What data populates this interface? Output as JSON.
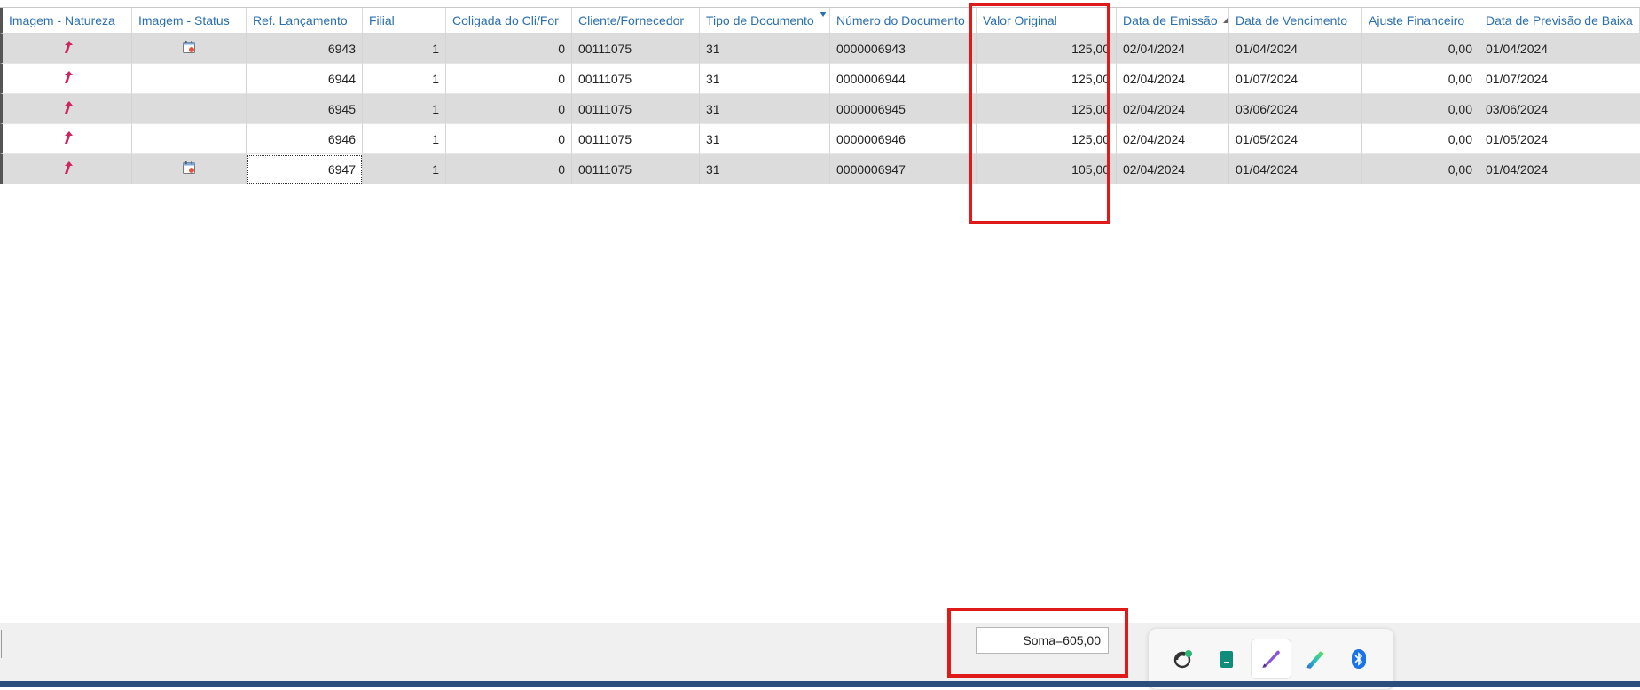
{
  "table": {
    "headers": [
      "Imagem - Natureza",
      "Imagem - Status",
      "Ref. Lançamento",
      "Filial",
      "Coligada do Cli/For",
      "Cliente/Fornecedor",
      "Tipo de Documento",
      "Número do Documento",
      "Valor Original",
      "Data de Emissão",
      "Data de Vencimento",
      "Ajuste Financeiro",
      "Data de Previsão de Baixa"
    ],
    "sorted_column": "Data de Emissão",
    "sort_direction": "ascending",
    "filtered_column": "Tipo de Documento",
    "rows": [
      {
        "natureza_icon": "up-arrow-icon",
        "status_icon": "calendar-icon",
        "ref": "6943",
        "filial": "1",
        "coligada": "0",
        "cliente": "00111075",
        "tipo": "31",
        "numero": "0000006943",
        "valor": "125,00",
        "emissao": "02/04/2024",
        "vencimento": "01/04/2024",
        "ajuste": "0,00",
        "previsao": "01/04/2024"
      },
      {
        "natureza_icon": "up-arrow-icon",
        "status_icon": "",
        "ref": "6944",
        "filial": "1",
        "coligada": "0",
        "cliente": "00111075",
        "tipo": "31",
        "numero": "0000006944",
        "valor": "125,00",
        "emissao": "02/04/2024",
        "vencimento": "01/07/2024",
        "ajuste": "0,00",
        "previsao": "01/07/2024"
      },
      {
        "natureza_icon": "up-arrow-icon",
        "status_icon": "",
        "ref": "6945",
        "filial": "1",
        "coligada": "0",
        "cliente": "00111075",
        "tipo": "31",
        "numero": "0000006945",
        "valor": "125,00",
        "emissao": "02/04/2024",
        "vencimento": "03/06/2024",
        "ajuste": "0,00",
        "previsao": "03/06/2024"
      },
      {
        "natureza_icon": "up-arrow-icon",
        "status_icon": "",
        "ref": "6946",
        "filial": "1",
        "coligada": "0",
        "cliente": "00111075",
        "tipo": "31",
        "numero": "0000006946",
        "valor": "125,00",
        "emissao": "02/04/2024",
        "vencimento": "01/05/2024",
        "ajuste": "0,00",
        "previsao": "01/05/2024"
      },
      {
        "natureza_icon": "up-arrow-icon",
        "status_icon": "calendar-icon",
        "ref": "6947",
        "filial": "1",
        "coligada": "0",
        "cliente": "00111075",
        "tipo": "31",
        "numero": "0000006947",
        "valor": "105,00",
        "emissao": "02/04/2024",
        "vencimento": "01/04/2024",
        "ajuste": "0,00",
        "previsao": "01/04/2024"
      }
    ],
    "focused_row": 4,
    "focused_field": "ref"
  },
  "footer": {
    "sum_text": "Soma=605,00"
  },
  "tray": {
    "icons": [
      "sync-icon",
      "notebook-icon",
      "pen-icon",
      "stylus-icon",
      "bluetooth-icon"
    ],
    "active_icon": "pen-icon"
  },
  "colors": {
    "header_text": "#2a6fb0",
    "highlight": "#e01919",
    "row_alt": "#dcdcdc",
    "natureza_arrow": "#d0245e",
    "taskbar": "#2b4e7d"
  }
}
